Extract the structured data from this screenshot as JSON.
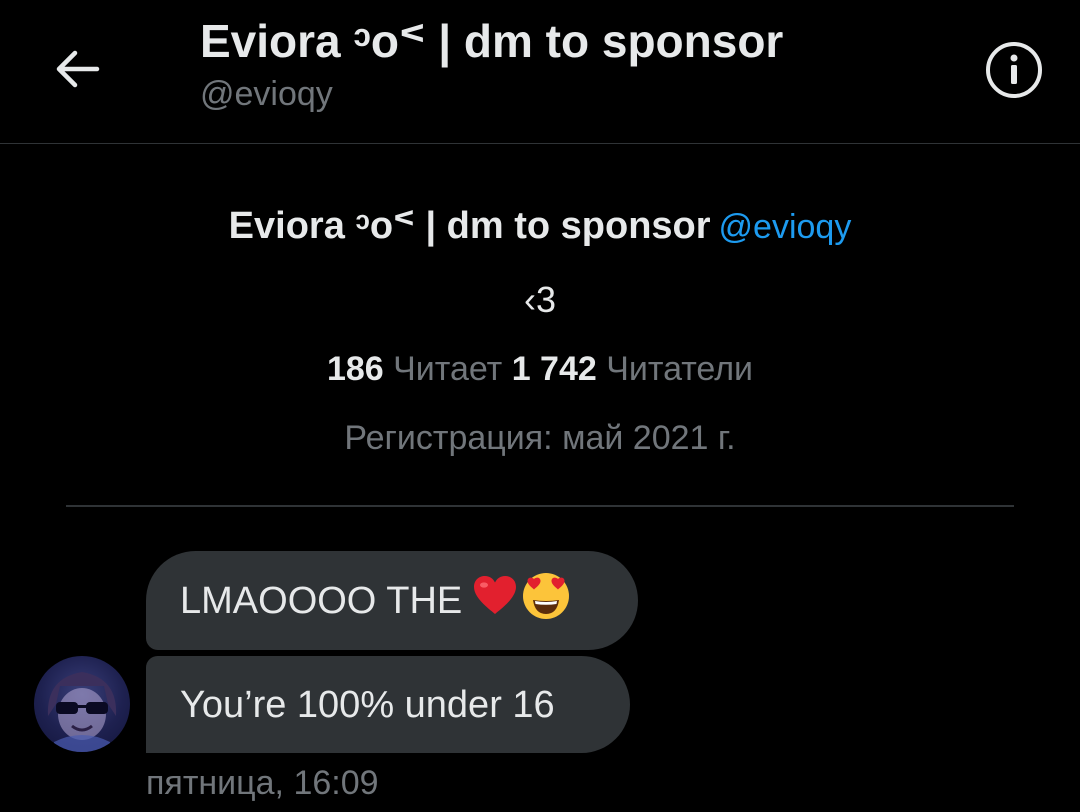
{
  "header": {
    "title": "Eviora ᵓoᑉ | dm to sponsor",
    "handle": "@evioqy"
  },
  "profile": {
    "name": "Eviora ᵓoᑉ | dm to sponsor",
    "handle": "@evioqy",
    "bio": "‹3",
    "following_count": "186",
    "following_label": "Читает",
    "followers_count": "1 742",
    "followers_label": "Читатели",
    "joined": "Регистрация: май 2021 г."
  },
  "messages": [
    {
      "text": "LMAOOOO THE",
      "emojis": [
        "heart-icon",
        "heart-eyes-emoji-icon"
      ]
    },
    {
      "text": "You’re 100% under 16"
    }
  ],
  "timestamp": "пятница, 16:09",
  "colors": {
    "background": "#000000",
    "bubble": "#2f3336",
    "primary_text": "#e7e9ea",
    "secondary_text": "#71767b",
    "link": "#1d9bf0"
  }
}
